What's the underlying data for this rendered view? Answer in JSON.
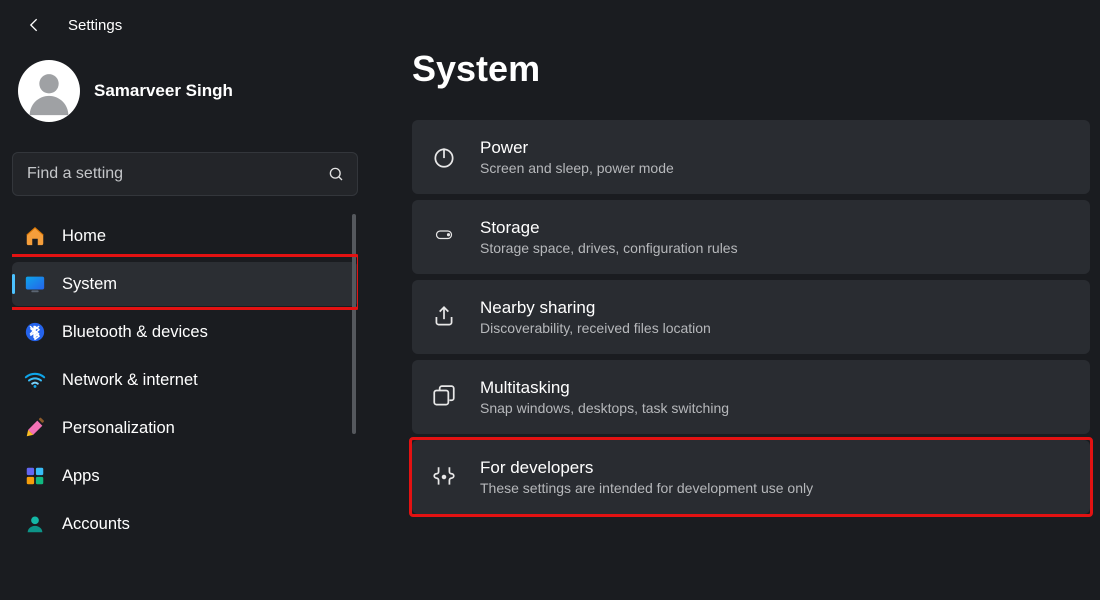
{
  "header": {
    "title": "Settings"
  },
  "account": {
    "name": "Samarveer Singh"
  },
  "search": {
    "placeholder": "Find a setting"
  },
  "sidebar": {
    "items": [
      {
        "label": "Home"
      },
      {
        "label": "System"
      },
      {
        "label": "Bluetooth & devices"
      },
      {
        "label": "Network & internet"
      },
      {
        "label": "Personalization"
      },
      {
        "label": "Apps"
      },
      {
        "label": "Accounts"
      }
    ]
  },
  "main": {
    "title": "System",
    "cards": [
      {
        "title": "Power",
        "desc": "Screen and sleep, power mode"
      },
      {
        "title": "Storage",
        "desc": "Storage space, drives, configuration rules"
      },
      {
        "title": "Nearby sharing",
        "desc": "Discoverability, received files location"
      },
      {
        "title": "Multitasking",
        "desc": "Snap windows, desktops, task switching"
      },
      {
        "title": "For developers",
        "desc": "These settings are intended for development use only"
      }
    ]
  }
}
